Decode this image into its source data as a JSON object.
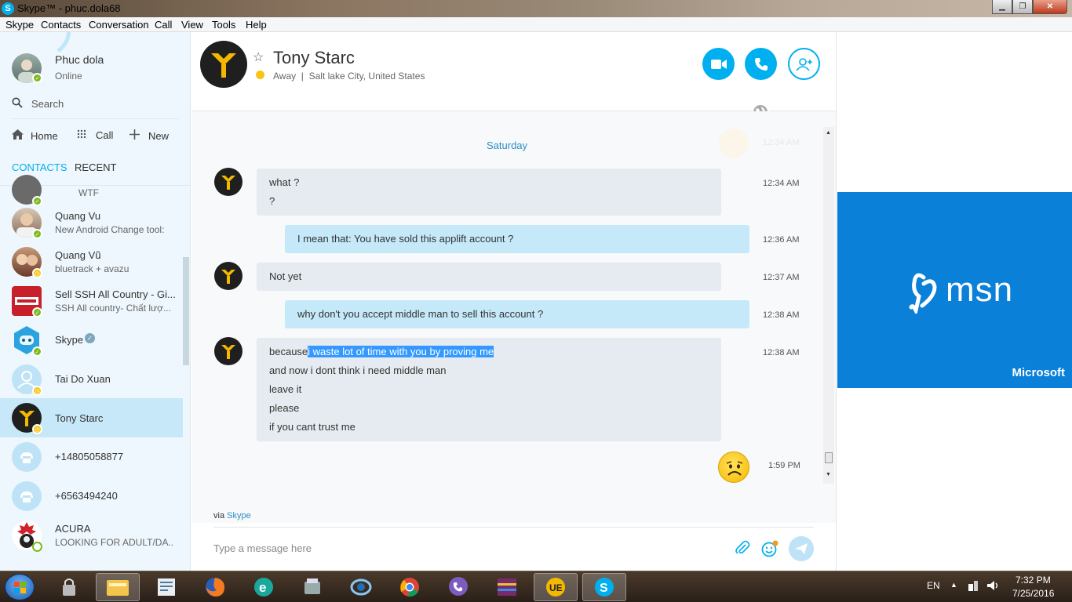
{
  "window": {
    "title": "Skype™ - phuc.dola68"
  },
  "menu": [
    "Skype",
    "Contacts",
    "Conversation",
    "Call",
    "View",
    "Tools",
    "Help"
  ],
  "me": {
    "name": "Phuc dola",
    "status": "Online"
  },
  "search": {
    "label": "Search"
  },
  "nav": {
    "home": "Home",
    "call": "Call",
    "new": "New"
  },
  "tabs": {
    "contacts": "CONTACTS",
    "recent": "RECENT"
  },
  "contacts": [
    {
      "name": "",
      "sub": "WTF",
      "status": "online"
    },
    {
      "name": "Quang Vu",
      "sub": "New Android Change tool:",
      "status": "online"
    },
    {
      "name": "Quang Vũ",
      "sub": "bluetrack  + avazu",
      "status": "away"
    },
    {
      "name": "Sell SSH All Country - Gi...",
      "sub": "SSH All country- Chất lượ...",
      "status": "online"
    },
    {
      "name": "Skype",
      "sub": "",
      "status": "online"
    },
    {
      "name": "Tai Do Xuan",
      "sub": "",
      "status": "away"
    },
    {
      "name": "Tony Starc",
      "sub": "",
      "status": "away"
    },
    {
      "name": "+14805058877",
      "sub": "",
      "status": "none"
    },
    {
      "name": "+6563494240",
      "sub": "",
      "status": "none"
    },
    {
      "name": "ACURA",
      "sub": "LOOKING FOR ADULT/DA...",
      "status": "offline"
    }
  ],
  "header": {
    "name": "Tony Starc",
    "status": "Away",
    "location": "Salt lake City, United States"
  },
  "conversation": {
    "day": "Saturday",
    "ghost_time": "12:34 AM",
    "messages": [
      {
        "dir": "in",
        "lines": [
          "what ?",
          "?"
        ],
        "time": "12:34 AM"
      },
      {
        "dir": "out",
        "lines": [
          "I mean that: You have sold this applift account ?"
        ],
        "time": "12:36 AM"
      },
      {
        "dir": "in",
        "lines": [
          "Not yet"
        ],
        "time": "12:37 AM"
      },
      {
        "dir": "out",
        "lines": [
          "why don't you accept middle man to sell this account ?"
        ],
        "time": "12:38 AM"
      },
      {
        "dir": "in",
        "lines": [
          "because",
          "i waste lot of time with you by proving me",
          "and now i dont think i need middle man",
          "leave it",
          "please",
          "if you cant trust me"
        ],
        "time": "12:38 AM"
      },
      {
        "dir": "out",
        "lines": [],
        "time": "1:59 PM",
        "emoticon": "worried"
      }
    ]
  },
  "via": {
    "prefix": "via",
    "service": "Skype"
  },
  "compose": {
    "placeholder": "Type a message here"
  },
  "ad": {
    "brand": "msn",
    "company": "Microsoft"
  },
  "taskbar": {
    "lang": "EN",
    "time": "7:32 PM",
    "date": "7/25/2016"
  },
  "colors": {
    "skype_blue": "#00aff0",
    "online": "#7cba1f",
    "away": "#f8c512",
    "highlight": "#3399ff",
    "msn_blue": "#0a80d8"
  }
}
